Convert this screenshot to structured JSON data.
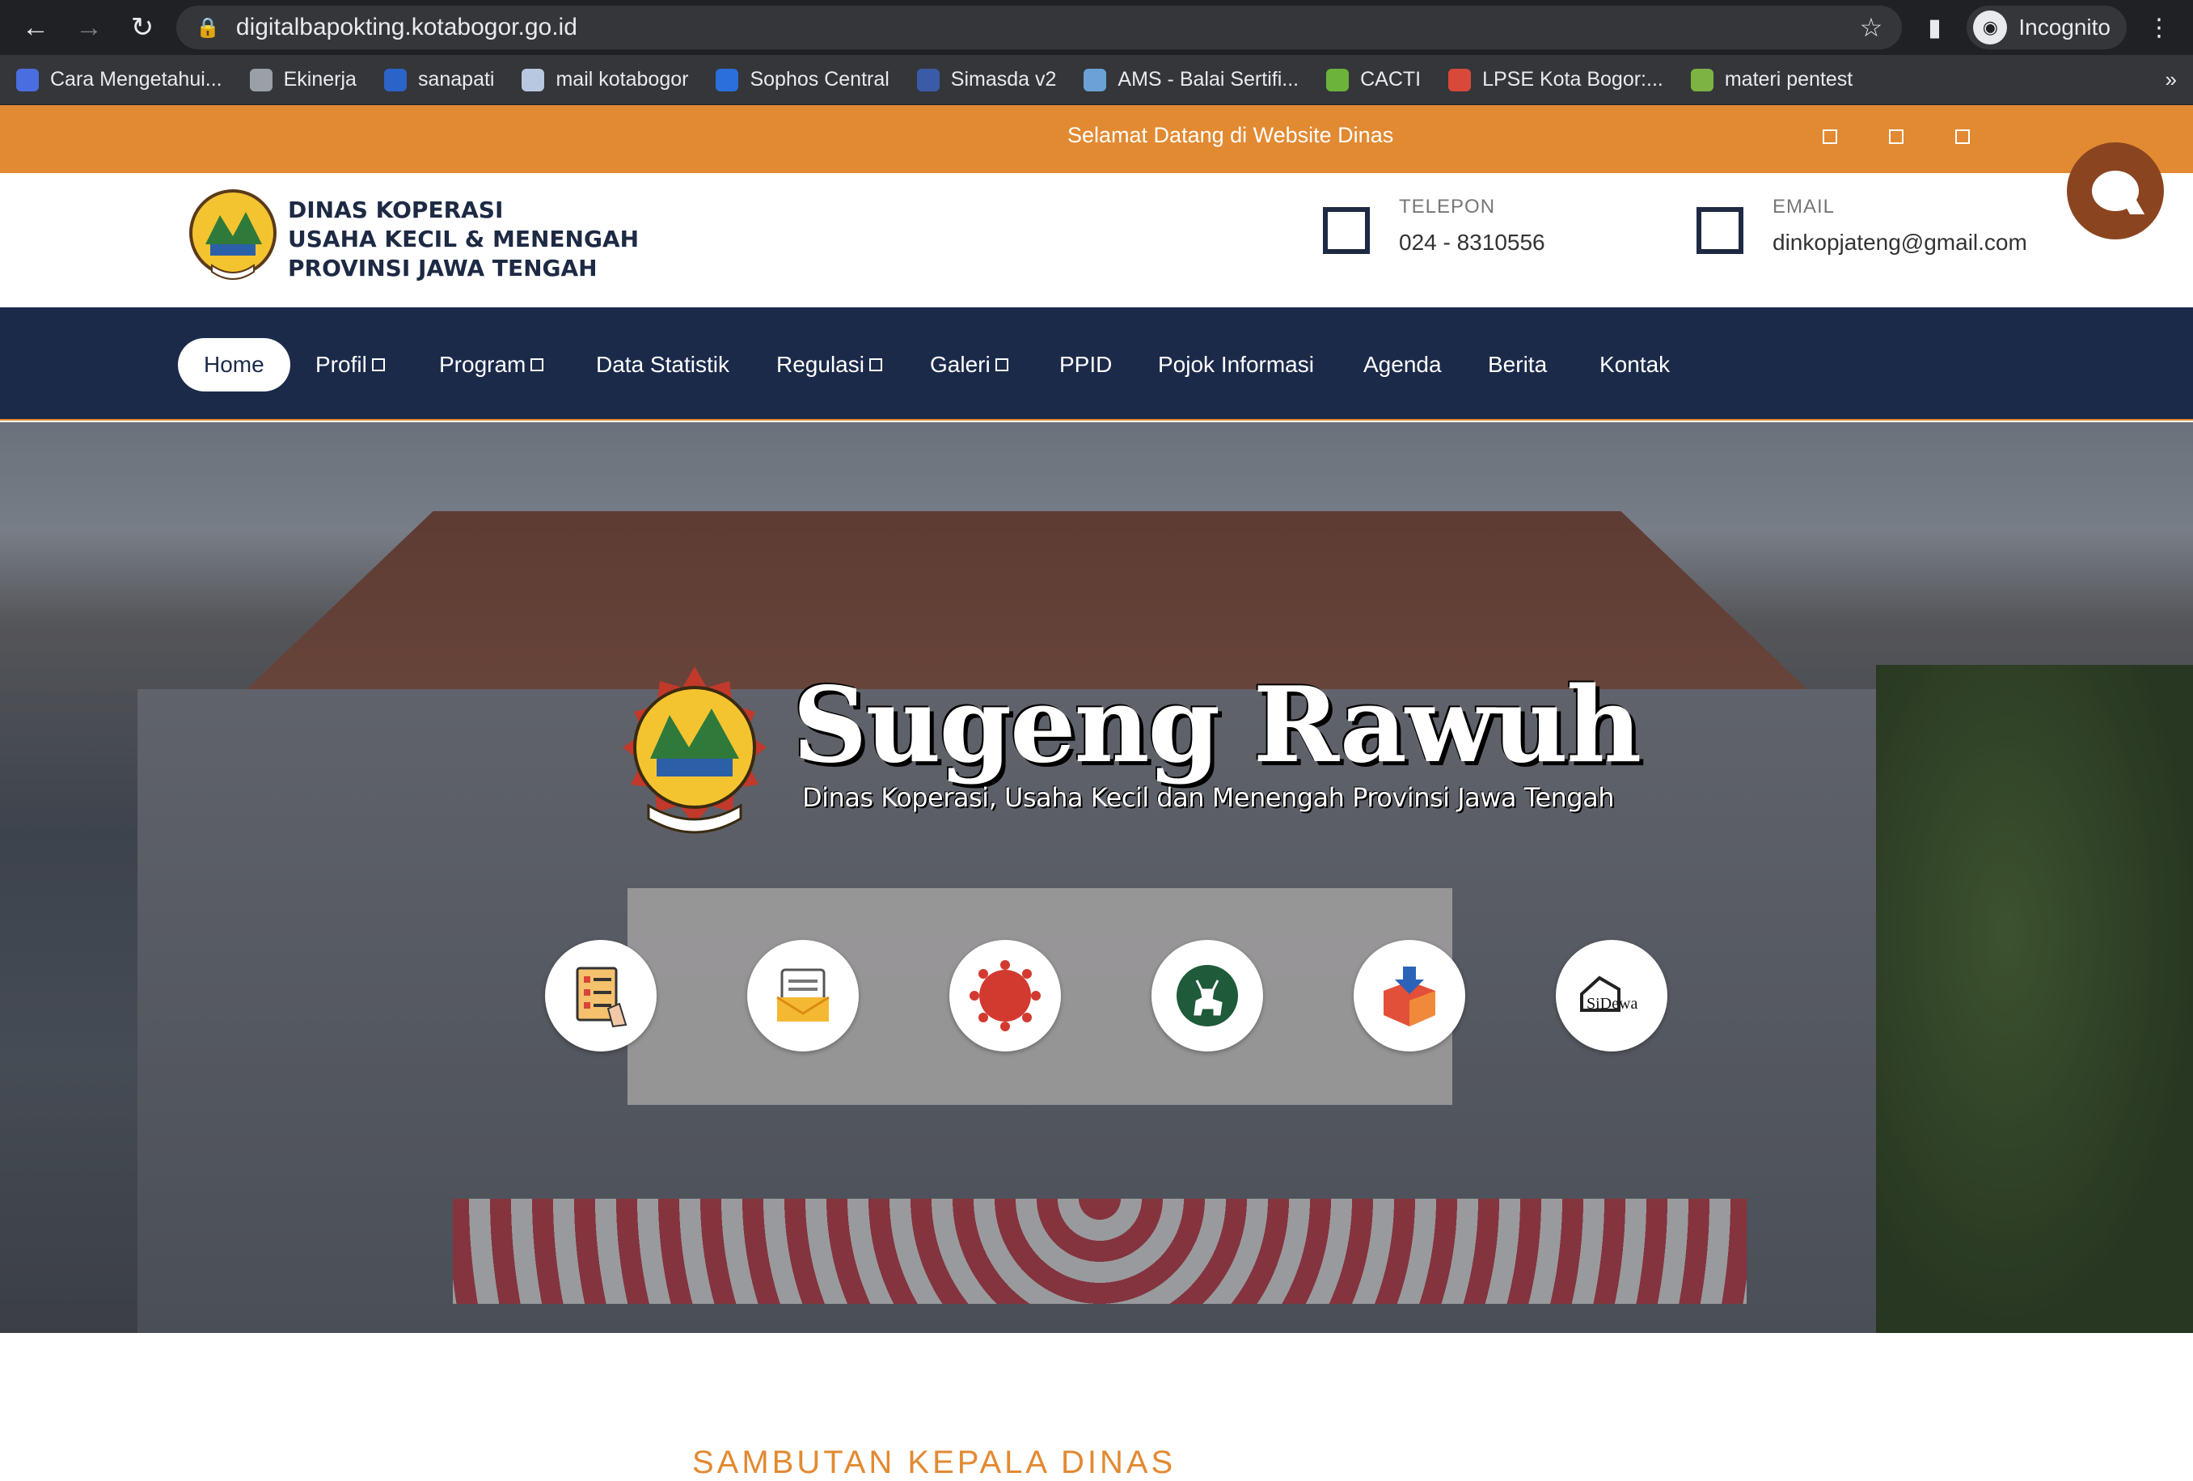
{
  "browser": {
    "url": "digitalbapokting.kotabogor.go.id",
    "profile_label": "Incognito",
    "more_bookmarks": "»",
    "bookmarks": [
      {
        "label": "Cara Mengetahui...",
        "color": "#4a6ee0"
      },
      {
        "label": "Ekinerja",
        "color": "#9aa0a6"
      },
      {
        "label": "sanapati",
        "color": "#2b64c9"
      },
      {
        "label": "mail kotabogor",
        "color": "#b8c8e0"
      },
      {
        "label": "Sophos Central",
        "color": "#2a6fdb"
      },
      {
        "label": "Simasda v2",
        "color": "#3b5ba8"
      },
      {
        "label": "AMS - Balai Sertifi...",
        "color": "#6aa2d8"
      },
      {
        "label": "CACTI",
        "color": "#6bb33a"
      },
      {
        "label": "LPSE Kota Bogor:...",
        "color": "#d9493a"
      },
      {
        "label": "materi pentest",
        "color": "#7cb342"
      }
    ]
  },
  "topbar": {
    "message": "Selamat Datang di Website Dinas",
    "color": "#e28a32"
  },
  "header": {
    "org_line1": "DINAS KOPERASI",
    "org_line2": "USAHA KECIL & MENENGAH",
    "org_line3": "PROVINSI JAWA TENGAH",
    "phone_label": "TELEPON",
    "phone_value": "024 - 8310556",
    "email_label": "EMAIL",
    "email_value": "dinkopjateng@gmail.com"
  },
  "nav": {
    "color": "#1c2a4a",
    "items": [
      {
        "label": "Home"
      },
      {
        "label": "Profil"
      },
      {
        "label": "Program"
      },
      {
        "label": "Data Statistik"
      },
      {
        "label": "Regulasi"
      },
      {
        "label": "Galeri"
      },
      {
        "label": "PPID"
      },
      {
        "label": "Pojok Informasi"
      },
      {
        "label": "Agenda"
      },
      {
        "label": "Berita"
      },
      {
        "label": "Kontak"
      }
    ]
  },
  "hero": {
    "title": "Sugeng Rawuh",
    "subtitle": "Dinas Koperasi, Usaha Kecil dan Menengah Provinsi Jawa Tengah",
    "services": [
      {
        "icon": "form-checklist-icon"
      },
      {
        "icon": "notepad-envelope-icon"
      },
      {
        "icon": "covid-virus-icon"
      },
      {
        "icon": "deer-emblem-icon"
      },
      {
        "icon": "download-box-icon"
      },
      {
        "icon": "sidewa-logo-icon",
        "label": "SiDewa"
      }
    ]
  },
  "section": {
    "heading_start": "SAMBUTAN",
    "heading_accent": "KEPALA DINAS"
  }
}
